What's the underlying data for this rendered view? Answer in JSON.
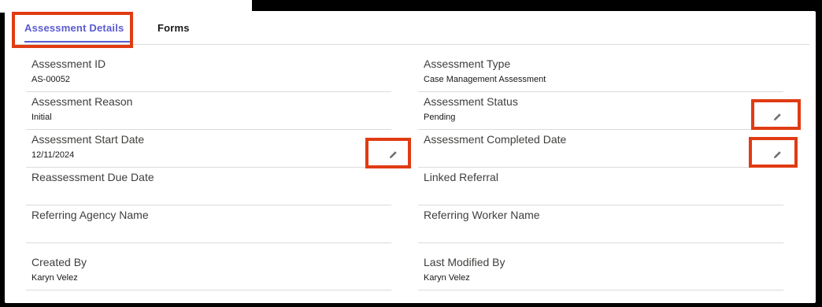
{
  "tabs": [
    {
      "label": "Assessment Details",
      "active": true
    },
    {
      "label": "Forms",
      "active": false
    }
  ],
  "fields": {
    "assessment_id": {
      "label": "Assessment ID",
      "value": "AS-00052"
    },
    "assessment_type": {
      "label": "Assessment Type",
      "value": "Case Management Assessment"
    },
    "assessment_reason": {
      "label": "Assessment Reason",
      "value": "Initial"
    },
    "assessment_status": {
      "label": "Assessment Status",
      "value": "Pending"
    },
    "assessment_start_date": {
      "label": "Assessment Start Date",
      "value": "12/11/2024"
    },
    "assessment_completed_date": {
      "label": "Assessment Completed Date",
      "value": ""
    },
    "reassessment_due_date": {
      "label": "Reassessment Due Date",
      "value": ""
    },
    "linked_referral": {
      "label": "Linked Referral",
      "value": ""
    },
    "referring_agency_name": {
      "label": "Referring Agency Name",
      "value": ""
    },
    "referring_worker_name": {
      "label": "Referring Worker Name",
      "value": ""
    },
    "created_by": {
      "label": "Created By",
      "value": "Karyn Velez"
    },
    "last_modified_by": {
      "label": "Last Modified By",
      "value": "Karyn Velez"
    }
  },
  "icons": {
    "edit": "pencil-icon"
  },
  "colors": {
    "accent": "#5a5bd1",
    "highlight": "#e03b13",
    "divider": "#dddbda"
  }
}
